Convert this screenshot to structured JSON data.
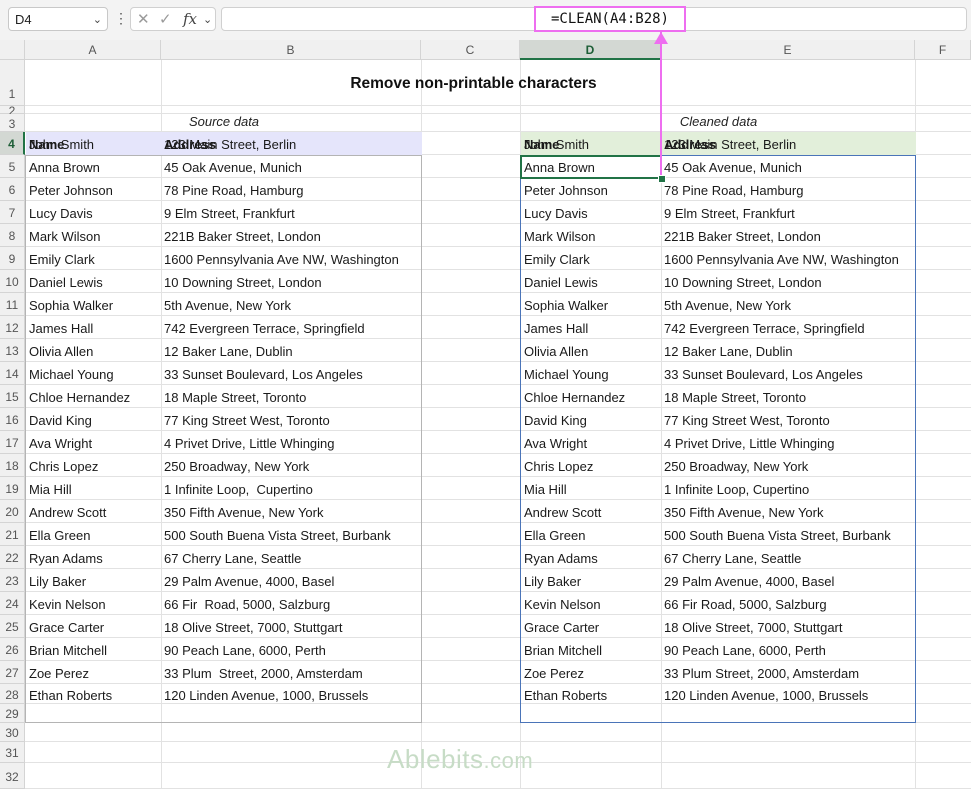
{
  "name_box": "D4",
  "formula": "=CLEAN(A4:B28)",
  "columns": [
    "A",
    "B",
    "C",
    "D",
    "E",
    "F"
  ],
  "title": "Remove non-printable characters",
  "source_label": "Source data",
  "cleaned_label": "Cleaned data",
  "headers": {
    "name": "Name",
    "address": "Address"
  },
  "source_rows": [
    {
      "name": "John \u0010\u0011\u0012Smith",
      "address": "123\u0011 Main \u0010\u0011\u0012Street, Berlin"
    },
    {
      "name": "Anna Brown",
      "address": "45 Oak\u0011\u0012 Avenue, Munich"
    },
    {
      "name": "Peter Johnson",
      "address": "78 Pine Road\u0011, Hamburg"
    },
    {
      "name": " Lucy Davis",
      "address": "9\u0011\u0012 Elm Street, Frankfurt"
    },
    {
      "name": "Mark Wilson",
      "address": "221B Baker\u0011 Street, \u0011London"
    },
    {
      "name": "Emily Clark",
      "address": "1600 Pennsylvania\u0011\u0012 Ave NW, Washington"
    },
    {
      "name": "Daniel Lewis",
      "address": "10 Downing\u0010\u0011\u0012 Street, London"
    },
    {
      "name": "Sophia Walker",
      "address": "5th\u0011 Avenue, New York"
    },
    {
      "name": "James \u0011\u0012Hall",
      "address": "742 Evergreen\u0011 Terrace, Springfield"
    },
    {
      "name": "Olivia Allen",
      "address": "12\u0011 Baker\u0011\u0012 Lane, Dublin"
    },
    {
      "name": "Michael Young",
      "address": "33\u0011 Sunset Boulevard, Los Angeles"
    },
    {
      "name": "Chloe Hernandez",
      "address": "18 Maple\u0011 Street,\u0011 \u0010\u0011\u0012Toronto"
    },
    {
      "name": "David King",
      "address": "77\u0011\u0012 King Street West, Toronto"
    },
    {
      "name": "Ava Wright",
      "address": "4 Privet\u0011 Drive, Little Whinging"
    },
    {
      "name": "Chris Lopez",
      "address": "250 Broadway\u0013, New York"
    },
    {
      "name": "\u0011\u0012Mia Hill",
      "address": "1 Infinite\u0011 Loop, \u0010\u0011\u0012 Cupertino"
    },
    {
      "name": "Andrew Scott",
      "address": "350 Fifth\u0011 Avenue, New York"
    },
    {
      "name": "Ella Green",
      "address": "500\u0011 South Buena Vista\u0011 Street, Burbank"
    },
    {
      "name": "Ryan Adams",
      "address": "67 Cherry \u0013Lane, Seattle"
    },
    {
      "name": "Lily Baker",
      "address": "29 Palm Avenue, 4000, Basel"
    },
    {
      "name": "Kevin Nelson\u0011\u0012",
      "address": "66 Fir \u0010\u0011\u0012  Road, 5000, Salzburg"
    },
    {
      "name": "Grace Carter",
      "address": "18 Olive Street, 7000, Stuttgart"
    },
    {
      "name": "Brian Mitchell",
      "address": "90 Peach Lane, 6000, Perth"
    },
    {
      "name": "Zoe Perez",
      "address": "33 Plum  \u0010\u0011\u0012 Street, 2000, Amsterdam"
    },
    {
      "name": "Ethan Roberts",
      "address": "120 Linden Avenue, 1000, Brussels"
    }
  ],
  "cleaned_rows": [
    {
      "name": "John Smith",
      "address": "123 Main Street, Berlin"
    },
    {
      "name": "Anna Brown",
      "address": "45 Oak Avenue, Munich"
    },
    {
      "name": "Peter Johnson",
      "address": "78 Pine Road, Hamburg"
    },
    {
      "name": "Lucy Davis",
      "address": "9 Elm Street, Frankfurt"
    },
    {
      "name": "Mark Wilson",
      "address": "221B Baker Street, London"
    },
    {
      "name": "Emily Clark",
      "address": "1600 Pennsylvania Ave NW, Washington"
    },
    {
      "name": "Daniel Lewis",
      "address": "10 Downing Street, London"
    },
    {
      "name": "Sophia Walker",
      "address": "5th Avenue, New York"
    },
    {
      "name": "James Hall",
      "address": "742 Evergreen Terrace, Springfield"
    },
    {
      "name": "Olivia Allen",
      "address": "12 Baker Lane, Dublin"
    },
    {
      "name": "Michael Young",
      "address": "33 Sunset Boulevard, Los Angeles"
    },
    {
      "name": "Chloe Hernandez",
      "address": "18 Maple Street, Toronto"
    },
    {
      "name": "David King",
      "address": "77 King Street West, Toronto"
    },
    {
      "name": "Ava Wright",
      "address": "4 Privet Drive, Little Whinging"
    },
    {
      "name": "Chris Lopez",
      "address": "250 Broadway, New York"
    },
    {
      "name": "Mia Hill",
      "address": "1 Infinite Loop,  Cupertino"
    },
    {
      "name": "Andrew Scott",
      "address": "350 Fifth Avenue, New York"
    },
    {
      "name": "Ella Green",
      "address": "500 South Buena Vista Street, Burbank"
    },
    {
      "name": "Ryan Adams",
      "address": "67 Cherry Lane, Seattle"
    },
    {
      "name": "Lily Baker",
      "address": "29 Palm Avenue, 4000, Basel"
    },
    {
      "name": "Kevin Nelson",
      "address": "66 Fir   Road, 5000, Salzburg"
    },
    {
      "name": "Grace Carter",
      "address": "18 Olive Street, 7000, Stuttgart"
    },
    {
      "name": "Brian Mitchell",
      "address": "90 Peach Lane, 6000, Perth"
    },
    {
      "name": "Zoe Perez",
      "address": "33 Plum   Street, 2000, Amsterdam"
    },
    {
      "name": "Ethan Roberts",
      "address": "120 Linden Avenue, 1000, Brussels"
    }
  ],
  "watermark": {
    "brand": "Ablebits",
    "suffix": ".com"
  },
  "colors": {
    "source_header": "#e5e5fb",
    "cleaned_header": "#e2efda",
    "accent": "#ee6ef0",
    "selection": "#217346"
  }
}
